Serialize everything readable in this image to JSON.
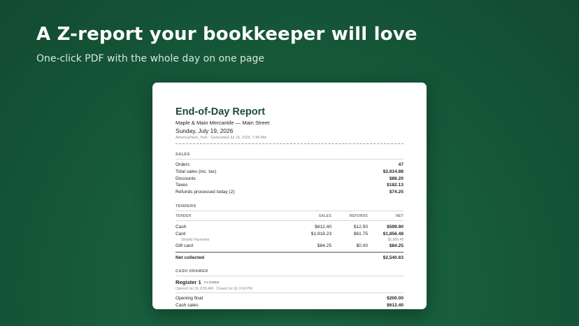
{
  "hero": {
    "title": "A Z-report your bookkeeper will love",
    "subtitle": "One-click PDF with the whole day on one page"
  },
  "report": {
    "title": "End-of-Day Report",
    "store": "Maple & Main Mercantile — Main Street",
    "date": "Sunday, July 19, 2026",
    "meta": "America/New_York · Generated Jul 19, 2026, 7:49 AM",
    "sales": {
      "heading": "SALES",
      "rows": [
        {
          "label": "Orders",
          "value": "47"
        },
        {
          "label": "Total sales (inc. tax)",
          "value": "$2,614.88"
        },
        {
          "label": "Discounts",
          "value": "$86.20"
        },
        {
          "label": "Taxes",
          "value": "$182.13"
        },
        {
          "label": "Refunds processed today (2)",
          "value": "$74.25"
        }
      ]
    },
    "tenders": {
      "heading": "TENDERS",
      "columns": [
        "TENDER",
        "SALES",
        "REFUNDS",
        "NET"
      ],
      "cash": {
        "tender": "Cash",
        "sales": "$612.40",
        "refunds": "$12.50",
        "net": "$599.90"
      },
      "card": {
        "tender": "Card",
        "sales": "$1,918.23",
        "refunds": "$61.75",
        "net": "$1,856.48"
      },
      "card_sub": {
        "tender": "Shopify Payments",
        "net": "$1,856.48"
      },
      "gift": {
        "tender": "Gift card",
        "sales": "$84.25",
        "refunds": "$0.00",
        "net": "$84.25"
      },
      "net_label": "Net collected",
      "net_value": "$2,540.63"
    },
    "cash_drawer": {
      "heading": "CASH DRAWER",
      "register_name": "Register 1",
      "register_status": "CLOSED",
      "register_meta": "Opened Jul 19, 8:55 AM · Closed Jul 19, 6:04 PM",
      "rows": [
        {
          "label": "Opening float",
          "value": "$200.00"
        },
        {
          "label": "Cash sales",
          "value": "$612.40"
        }
      ]
    }
  }
}
